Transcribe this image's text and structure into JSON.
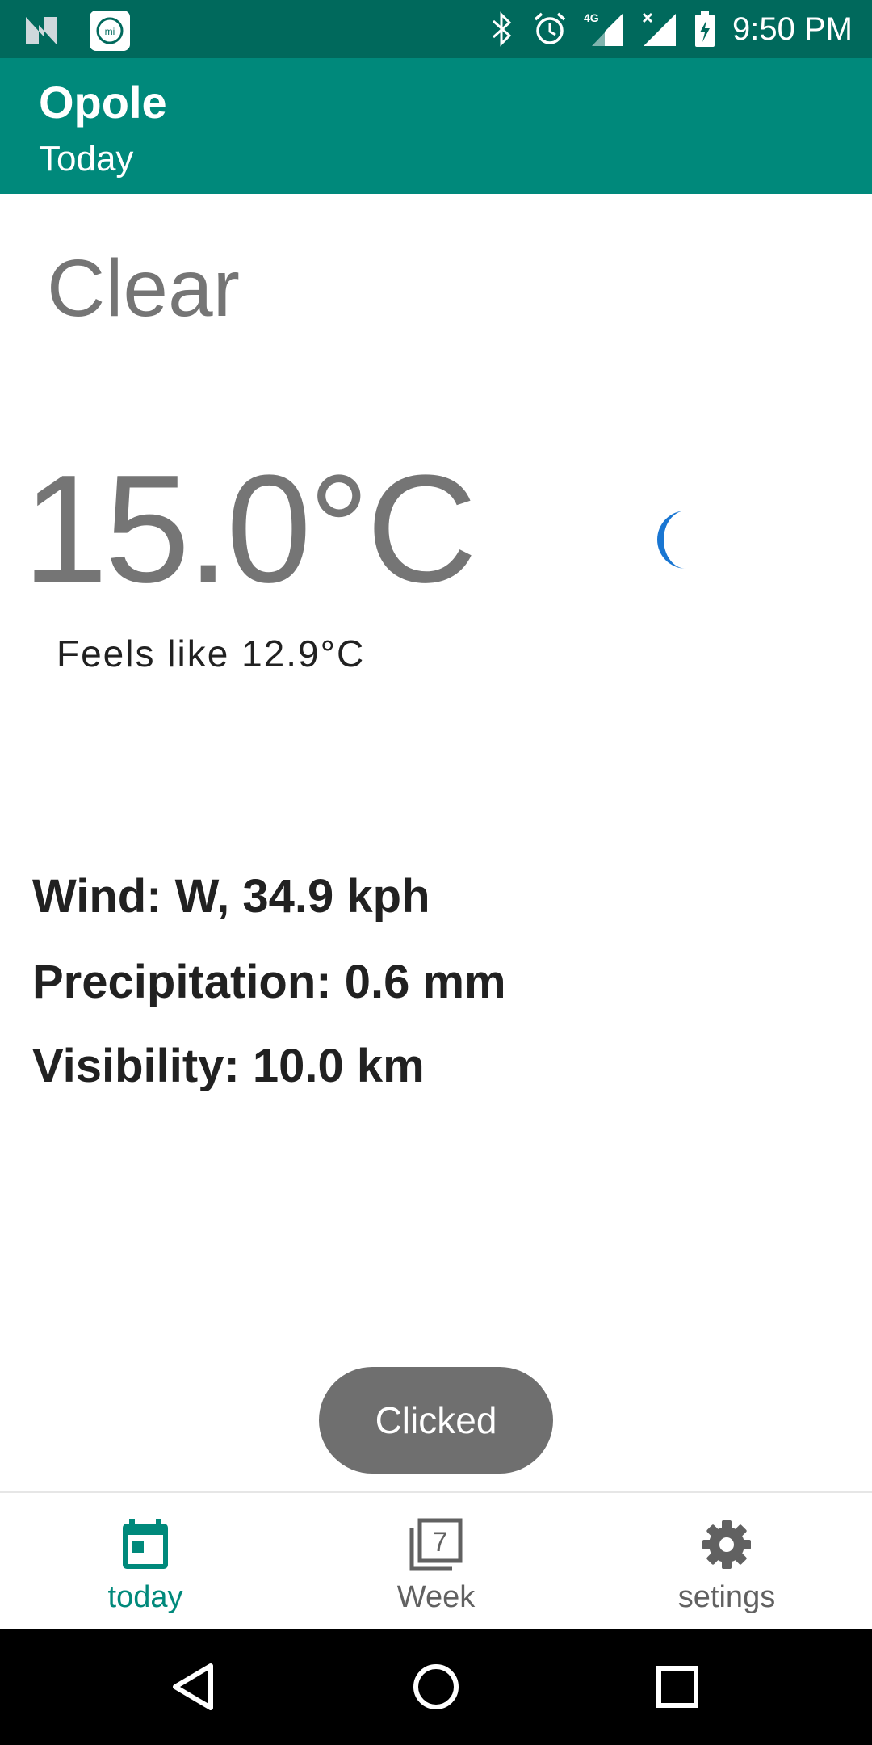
{
  "status_bar": {
    "time": "9:50 PM",
    "network": "4G",
    "icons": [
      "notification-n-icon",
      "mi-icon",
      "bluetooth-icon",
      "alarm-icon",
      "signal-4g-icon",
      "signal-no-data-icon",
      "battery-charging-icon"
    ]
  },
  "app_bar": {
    "title": "Opole",
    "subtitle": "Today"
  },
  "weather": {
    "condition": "Clear",
    "temperature": "15.0°C",
    "feels_like": "Feels like 12.9°C",
    "icon": "moon-icon",
    "icon_color": "#1976d2",
    "details": {
      "wind": "Wind: W, 34.9 kph",
      "precipitation": "Precipitation: 0.6 mm",
      "visibility": "Visibility: 10.0 km"
    }
  },
  "toast": {
    "text": "Clicked"
  },
  "bottom_nav": {
    "items": [
      {
        "label": "today",
        "icon": "calendar-icon",
        "active": true
      },
      {
        "label": "Week",
        "icon": "calendar-week-icon",
        "badge": "7",
        "active": false
      },
      {
        "label": "setings",
        "icon": "gear-icon",
        "active": false
      }
    ]
  },
  "colors": {
    "status_bar": "#00695c",
    "app_bar": "#00897b",
    "accent": "#00897b",
    "toast_bg": "#6f6f6f"
  }
}
